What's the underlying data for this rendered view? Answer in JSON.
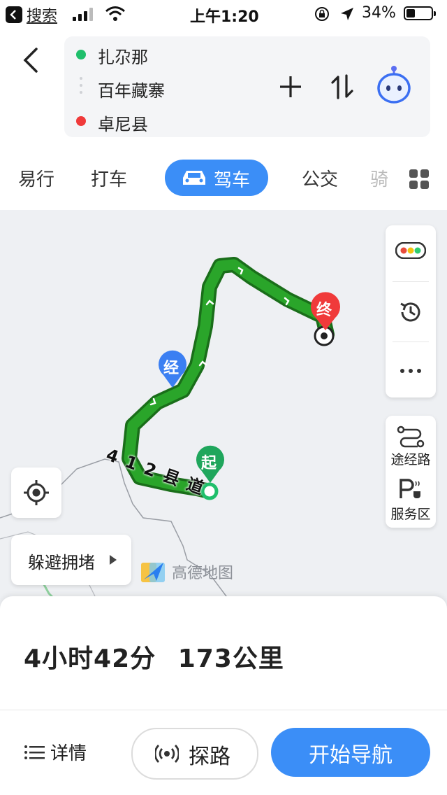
{
  "status_bar": {
    "back_app": "搜索",
    "time": "上午1:20",
    "battery_percent": "34%",
    "battery_level": 0.34
  },
  "route": {
    "origin": "扎尕那",
    "waypoint": "百年藏寨",
    "destination": "卓尼县",
    "colors": {
      "origin": "#1fbf6b",
      "destination": "#f03a3a"
    }
  },
  "tabs": {
    "items": [
      "易行",
      "打车",
      "驾车",
      "公交",
      "骑"
    ],
    "active": "驾车"
  },
  "map": {
    "road_label": "412县道",
    "markers": {
      "start": "起",
      "waypoint": "经",
      "end": "终"
    },
    "avoid_congestion": "躲避拥堵",
    "watermark": "高德地图",
    "side_buttons": {
      "waypoint": "途经路",
      "service_area": "服务区"
    },
    "colors": {
      "route": "#2aa52a",
      "route_border": "#1a6e1a",
      "accent": "#3b8ef7"
    }
  },
  "summary": {
    "duration": "4小时42分",
    "distance": "173公里"
  },
  "bottom": {
    "details": "详情",
    "explore": "探路",
    "start_navigation": "开始导航"
  }
}
